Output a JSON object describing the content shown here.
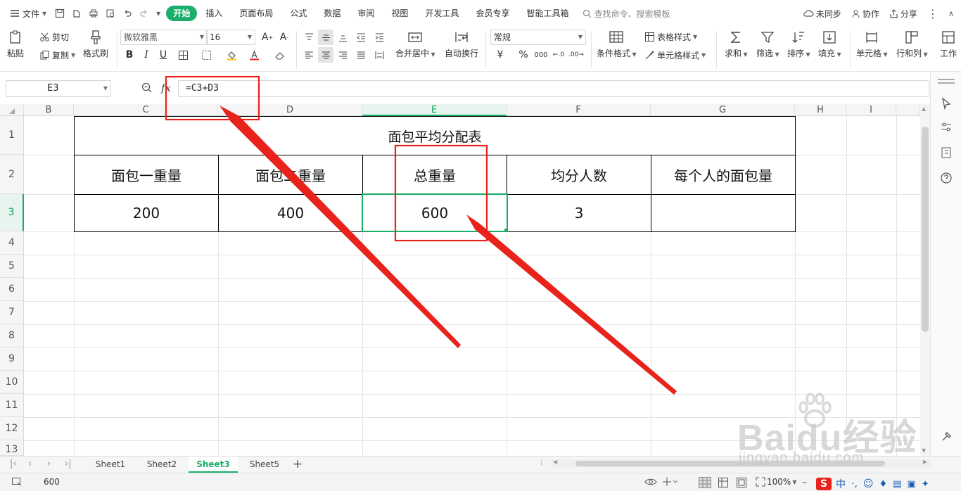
{
  "menubar": {
    "file": "文件",
    "tabs": [
      "开始",
      "插入",
      "页面布局",
      "公式",
      "数据",
      "审阅",
      "视图",
      "开发工具",
      "会员专享",
      "智能工具箱"
    ],
    "active_tab": "开始",
    "search_placeholder": "查找命令、搜索模板",
    "sync": "未同步",
    "collab": "协作",
    "share": "分享"
  },
  "ribbon": {
    "paste": "粘贴",
    "cut": "剪切",
    "copy": "复制",
    "format_painter": "格式刷",
    "font_name": "微软雅黑",
    "font_size": "16",
    "bold": "B",
    "italic": "I",
    "underline": "U",
    "merge_center": "合并居中",
    "wrap_text": "自动换行",
    "number_format": "常规",
    "currency": "¥",
    "percent": "%",
    "thousands": "000",
    "cond_format": "条件格式",
    "table_style": "表格样式",
    "cell_style": "单元格样式",
    "sum": "求和",
    "filter": "筛选",
    "sort": "排序",
    "fill": "填充",
    "cell": "单元格",
    "row_col": "行和列",
    "worksheet": "工作"
  },
  "formula_bar": {
    "name_box": "E3",
    "fx": "fx",
    "formula": "=C3+D3"
  },
  "grid": {
    "columns": [
      "B",
      "C",
      "D",
      "E",
      "F",
      "G",
      "H",
      "I"
    ],
    "selected_column": "E",
    "rows": [
      "1",
      "2",
      "3",
      "4",
      "5",
      "6",
      "7",
      "8",
      "9",
      "10",
      "11",
      "12",
      "13"
    ],
    "selected_row": "3",
    "title": "面包平均分配表",
    "headers": [
      "面包一重量",
      "面包二重量",
      "总重量",
      "均分人数",
      "每个人的面包量"
    ],
    "values": [
      "200",
      "400",
      "600",
      "3",
      ""
    ]
  },
  "sheets": [
    "Sheet1",
    "Sheet2",
    "Sheet3",
    "Sheet5"
  ],
  "active_sheet": "Sheet3",
  "status": {
    "value": "600",
    "zoom": "100%"
  },
  "watermark": {
    "brand": "Baidu经验",
    "url": "jingyan.baidu.com"
  },
  "colors": {
    "accent": "#1aae6a",
    "annotation": "#e8231b"
  }
}
